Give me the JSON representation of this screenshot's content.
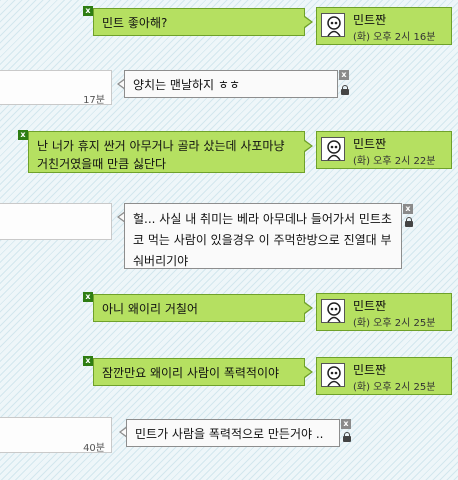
{
  "contact": {
    "name": "민트짠",
    "avatar_icon": "skull-character-icon"
  },
  "messages": [
    {
      "side": "right",
      "text": "민트 좋아해?",
      "time": "(화) 오후 2시 16분"
    },
    {
      "side": "left",
      "text": "양치는 맨날하지 ㅎㅎ",
      "time": "17분"
    },
    {
      "side": "right",
      "text": "난 너가 휴지 싼거 아무거나 골라 샀는데 사포마냥 거친거였을때 만큼 싫단다",
      "time": "(화) 오후 2시 22분"
    },
    {
      "side": "left",
      "text": "헐... 사실 내 취미는 베라 아무데나 들어가서 민트초코 먹는 사람이 있을경우 이 주먹한방으로 진열대 부숴버리기야",
      "time": ""
    },
    {
      "side": "right",
      "text": "아니 왜이리 거칠어",
      "time": "(화) 오후 2시 25분"
    },
    {
      "side": "right",
      "text": "잠깐만요 왜이리 사람이 폭력적이야",
      "time": "(화) 오후 2시 25분"
    },
    {
      "side": "left",
      "text": "민트가 사람을 폭력적으로 만든거야 ..",
      "time": "40분"
    }
  ],
  "icons": {
    "delete": "x",
    "lock": "lock-icon"
  },
  "colors": {
    "sent_bubble": "#b5e061",
    "sent_border": "#6fa12a",
    "received_bubble": "#fafafa"
  }
}
